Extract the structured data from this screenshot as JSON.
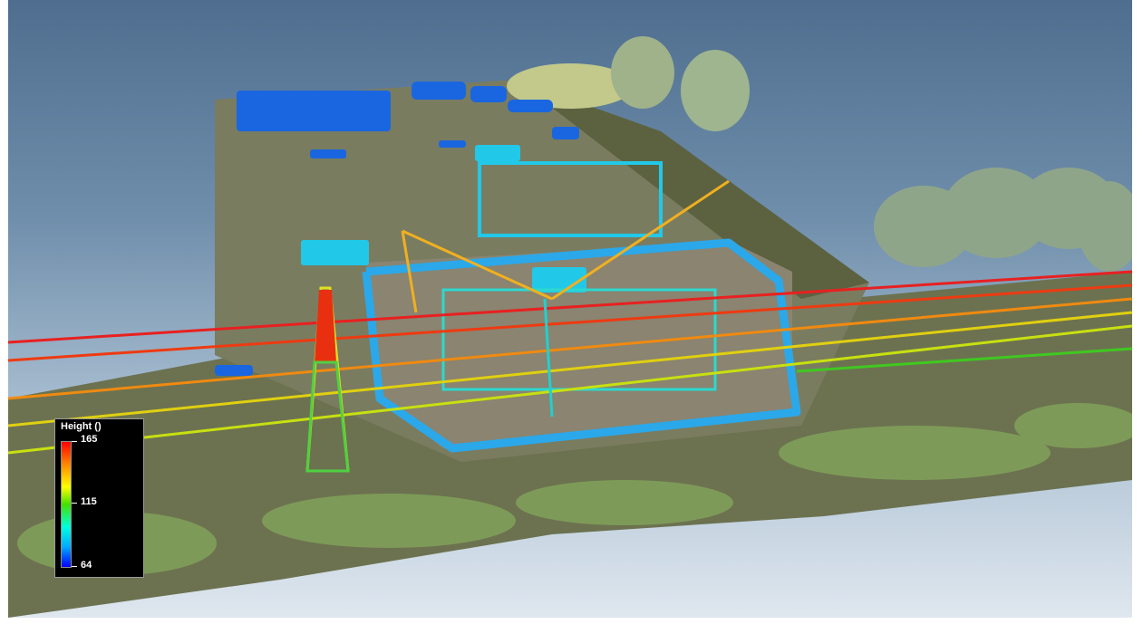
{
  "viewer": {
    "legend": {
      "title": "Height ()",
      "max_label": "165",
      "mid_label": "115",
      "min_label": "64",
      "colormap": [
        "#0000ff",
        "#00aaff",
        "#00ffdd",
        "#44e000",
        "#ffff00",
        "#ff8800",
        "#ff0000"
      ]
    }
  }
}
